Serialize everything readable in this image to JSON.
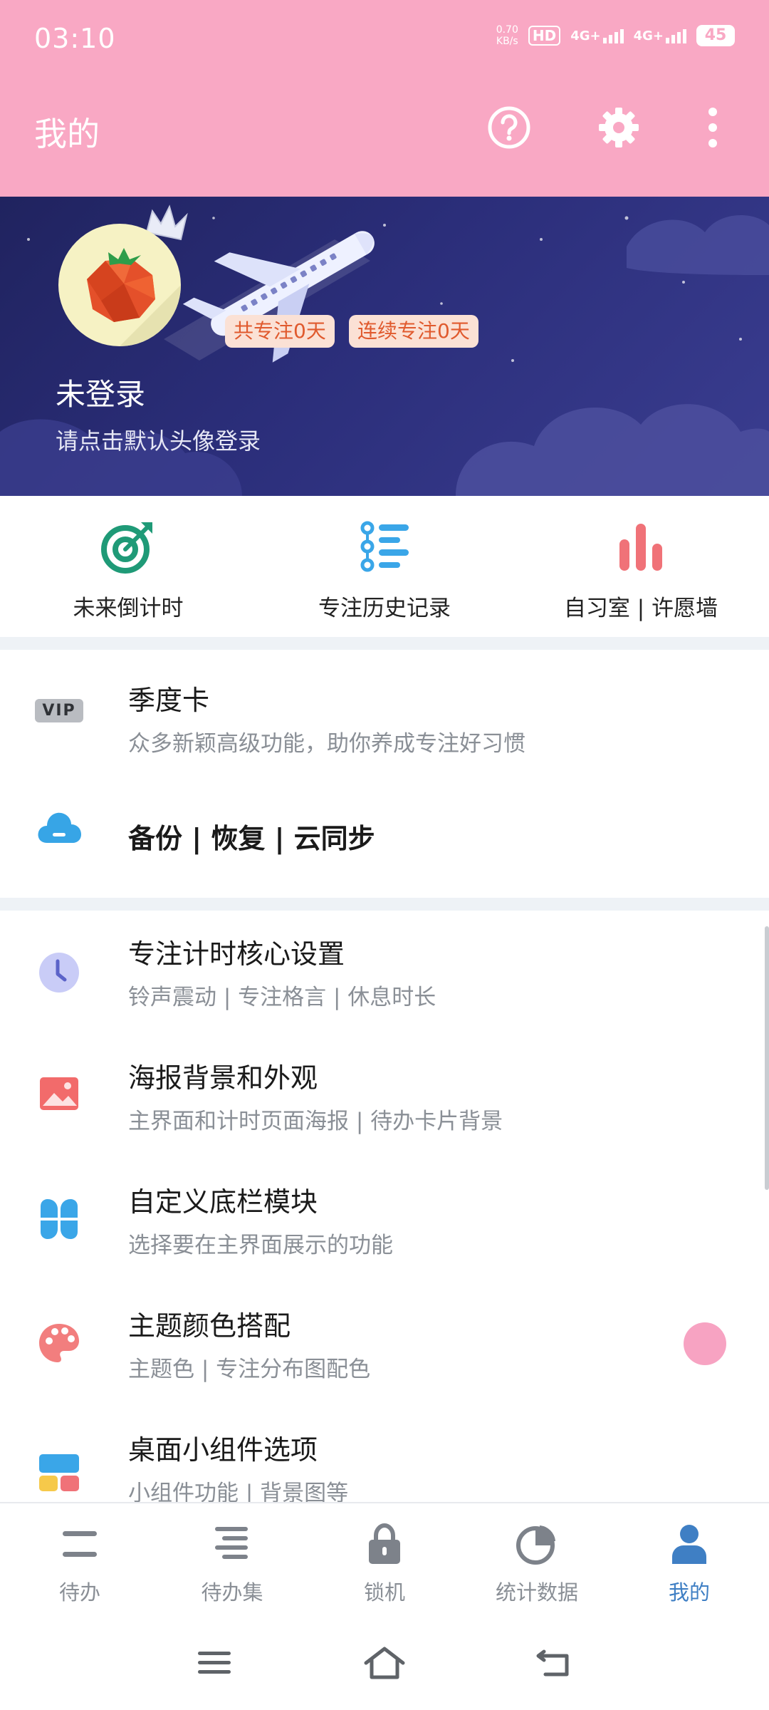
{
  "status": {
    "time": "03:10",
    "speed_value": "0.70",
    "speed_unit": "KB/s",
    "hd_label": "HD",
    "net1": "4G+",
    "net2": "4G+",
    "battery": "45"
  },
  "header": {
    "title": "我的",
    "icons": [
      "help-icon",
      "settings-gear-icon",
      "more-vertical-icon"
    ]
  },
  "profile": {
    "badge_total": "共专注0天",
    "badge_streak": "连续专注0天",
    "username": "未登录",
    "login_hint": "请点击默认头像登录"
  },
  "quick_actions": [
    {
      "label": "未来倒计时",
      "icon": "target-icon",
      "color": "#1f9a77"
    },
    {
      "label": "专注历史记录",
      "icon": "timeline-list-icon",
      "color": "#3aa6e8"
    },
    {
      "label": "自习室 | 许愿墙",
      "icon": "bar-chart-icon",
      "color": "#f07278"
    }
  ],
  "menu": {
    "vip": {
      "badge": "VIP",
      "title": "季度卡",
      "subtitle": "众多新颖高级功能，助你养成专注好习惯"
    },
    "backup": {
      "title": "备份 | 恢复 | 云同步"
    },
    "core": {
      "title": "专注计时核心设置",
      "subtitle": "铃声震动 | 专注格言 | 休息时长"
    },
    "poster": {
      "title": "海报背景和外观",
      "subtitle": "主界面和计时页面海报 | 待办卡片背景"
    },
    "bottom_bar": {
      "title": "自定义底栏模块",
      "subtitle": "选择要在主界面展示的功能"
    },
    "theme": {
      "title": "主题颜色搭配",
      "subtitle": "主题色 | 专注分布图配色",
      "swatch": "#f7a3c2"
    },
    "widget": {
      "title": "桌面小组件选项",
      "subtitle": "小组件功能 | 背景图等"
    }
  },
  "tabs": [
    {
      "label": "待办",
      "icon": "todo-icon",
      "active": false
    },
    {
      "label": "待办集",
      "icon": "todo-set-icon",
      "active": false
    },
    {
      "label": "锁机",
      "icon": "lock-icon",
      "active": false
    },
    {
      "label": "统计数据",
      "icon": "pie-chart-icon",
      "active": false
    },
    {
      "label": "我的",
      "icon": "person-icon",
      "active": true
    }
  ],
  "colors": {
    "header_bg": "#f9a8c4",
    "banner_bg": "#2b2e7a",
    "active_tab": "#3f7fc4",
    "muted_text": "#8a8f96"
  }
}
